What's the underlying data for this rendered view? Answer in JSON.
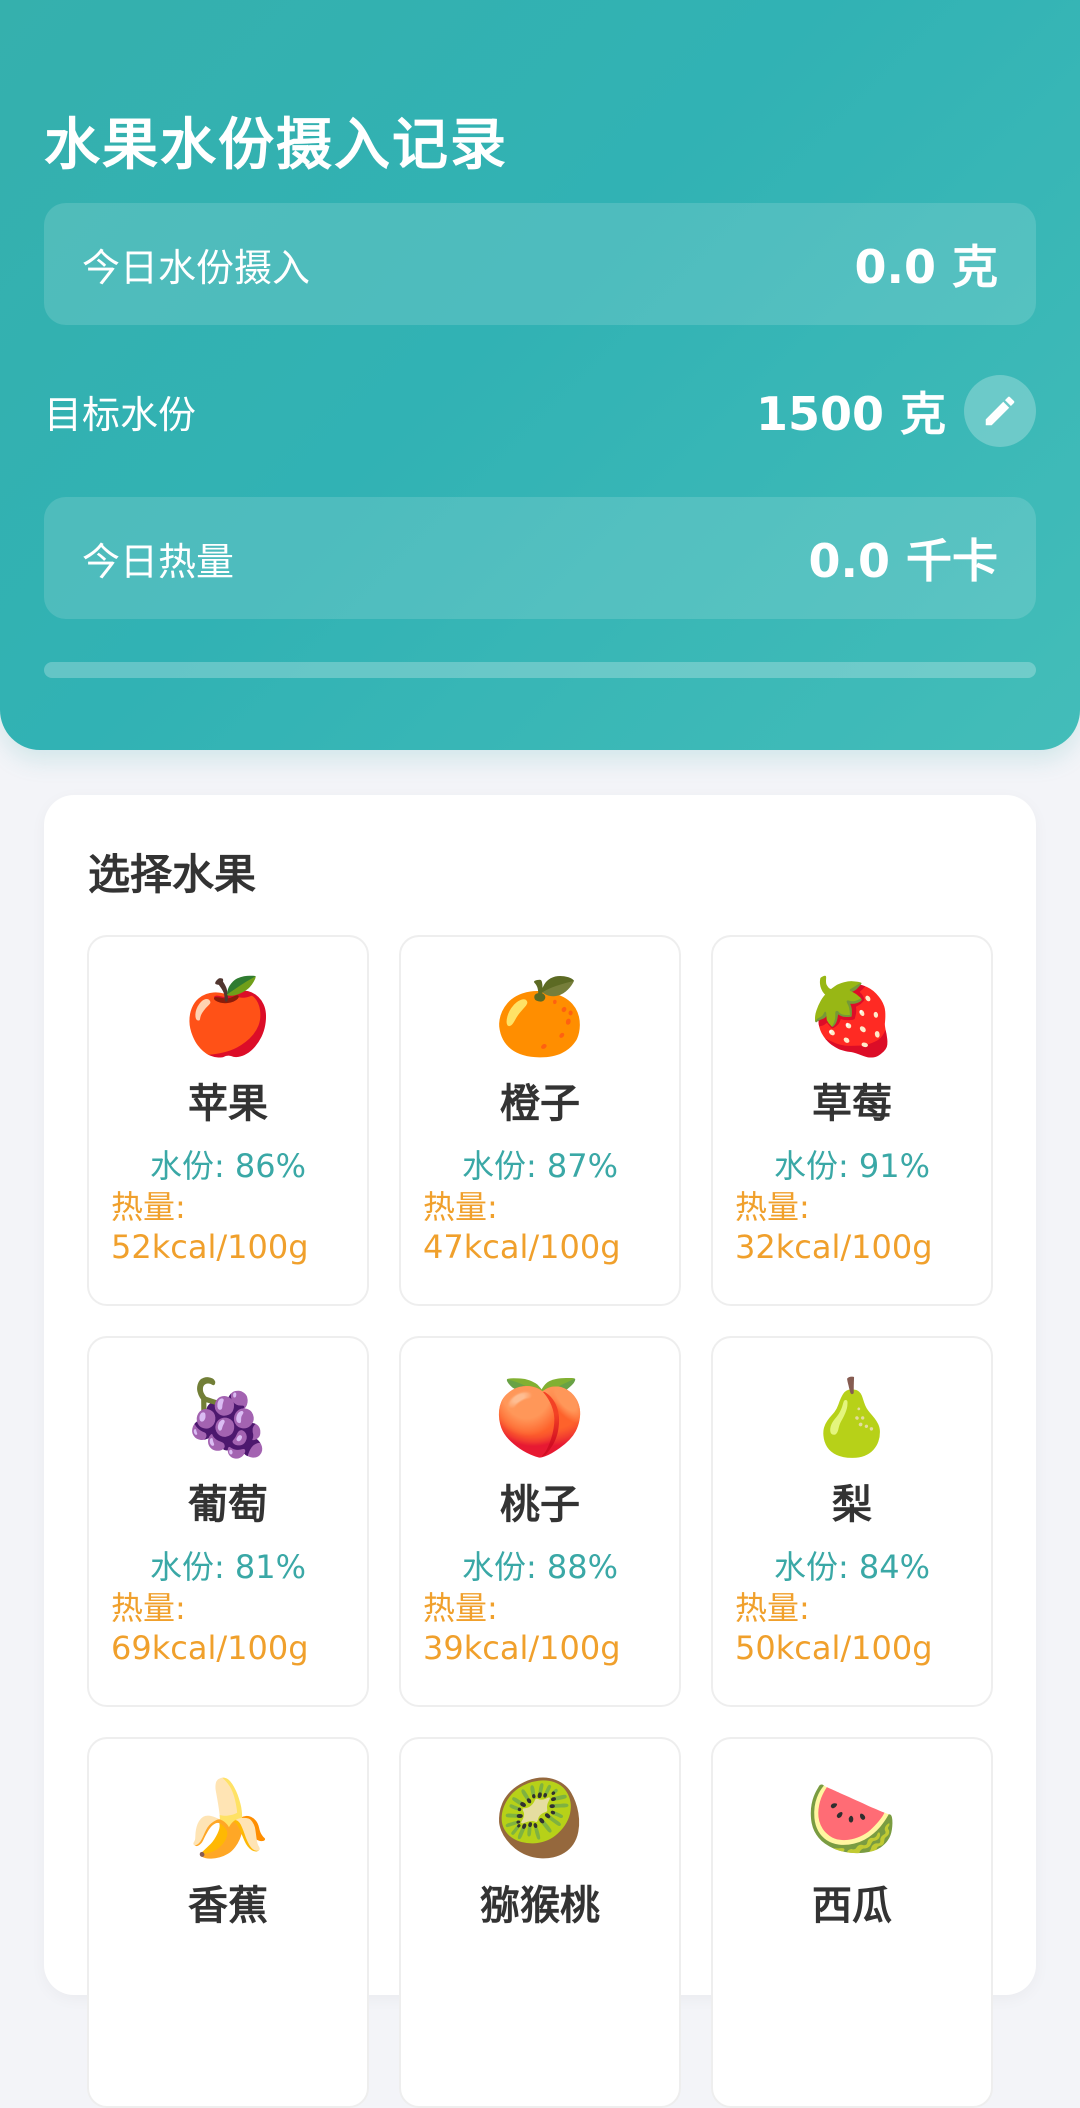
{
  "header": {
    "title": "水果水份摄入记录",
    "today_water": {
      "label": "今日水份摄入",
      "value": "0.0 克"
    },
    "goal": {
      "label": "目标水份",
      "value": "1500 克",
      "edit_icon": "pencil-icon"
    },
    "today_calories": {
      "label": "今日热量",
      "value": "0.0 千卡"
    },
    "progress_fraction": 0
  },
  "fruit_panel": {
    "title": "选择水果",
    "fruits": [
      {
        "emoji": "🍎",
        "name": "苹果",
        "water": "水份: 86%",
        "calories": "热量: 52kcal/100g"
      },
      {
        "emoji": "🍊",
        "name": "橙子",
        "water": "水份: 87%",
        "calories": "热量: 47kcal/100g"
      },
      {
        "emoji": "🍓",
        "name": "草莓",
        "water": "水份: 91%",
        "calories": "热量: 32kcal/100g"
      },
      {
        "emoji": "🍇",
        "name": "葡萄",
        "water": "水份: 81%",
        "calories": "热量: 69kcal/100g"
      },
      {
        "emoji": "🍑",
        "name": "桃子",
        "water": "水份: 88%",
        "calories": "热量: 39kcal/100g"
      },
      {
        "emoji": "🍐",
        "name": "梨",
        "water": "水份: 84%",
        "calories": "热量: 50kcal/100g"
      },
      {
        "emoji": "🍌",
        "name": "香蕉",
        "water": "",
        "calories": ""
      },
      {
        "emoji": "🥝",
        "name": "猕猴桃",
        "water": "",
        "calories": ""
      },
      {
        "emoji": "🍉",
        "name": "西瓜",
        "water": "",
        "calories": ""
      }
    ]
  },
  "colors": {
    "accent": "#35b0ad",
    "water_text": "#3aa8a6",
    "calorie_text": "#f0a02c"
  }
}
